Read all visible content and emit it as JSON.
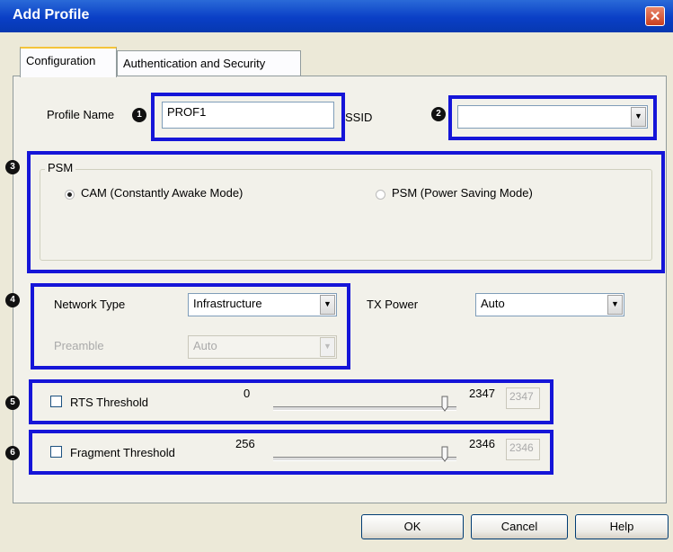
{
  "window": {
    "title": "Add Profile",
    "close_symbol": "✕"
  },
  "tabs": [
    {
      "label": "Configuration",
      "active": true
    },
    {
      "label": "Authentication and Security",
      "active": false
    }
  ],
  "badges": [
    "1",
    "2",
    "3",
    "4",
    "5",
    "6"
  ],
  "profile": {
    "label": "Profile Name",
    "value": "PROF1"
  },
  "ssid": {
    "label": "SSID",
    "value": ""
  },
  "psm": {
    "legend": "PSM",
    "options": [
      {
        "label": "CAM (Constantly Awake Mode)",
        "selected": true
      },
      {
        "label": "PSM (Power Saving Mode)",
        "selected": false
      }
    ]
  },
  "network": {
    "type_label": "Network Type",
    "type_value": "Infrastructure",
    "preamble_label": "Preamble",
    "preamble_value": "Auto"
  },
  "tx_power": {
    "label": "TX Power",
    "value": "Auto"
  },
  "rts": {
    "label": "RTS Threshold",
    "min": "0",
    "max": "2347",
    "value": "2347",
    "checked": false
  },
  "fragment": {
    "label": "Fragment Threshold",
    "min": "256",
    "max": "2346",
    "value": "2346",
    "checked": false
  },
  "buttons": {
    "ok": "OK",
    "cancel": "Cancel",
    "help": "Help"
  },
  "colors": {
    "highlight": "#1515d8",
    "titlebar": "#0a3fc6"
  }
}
